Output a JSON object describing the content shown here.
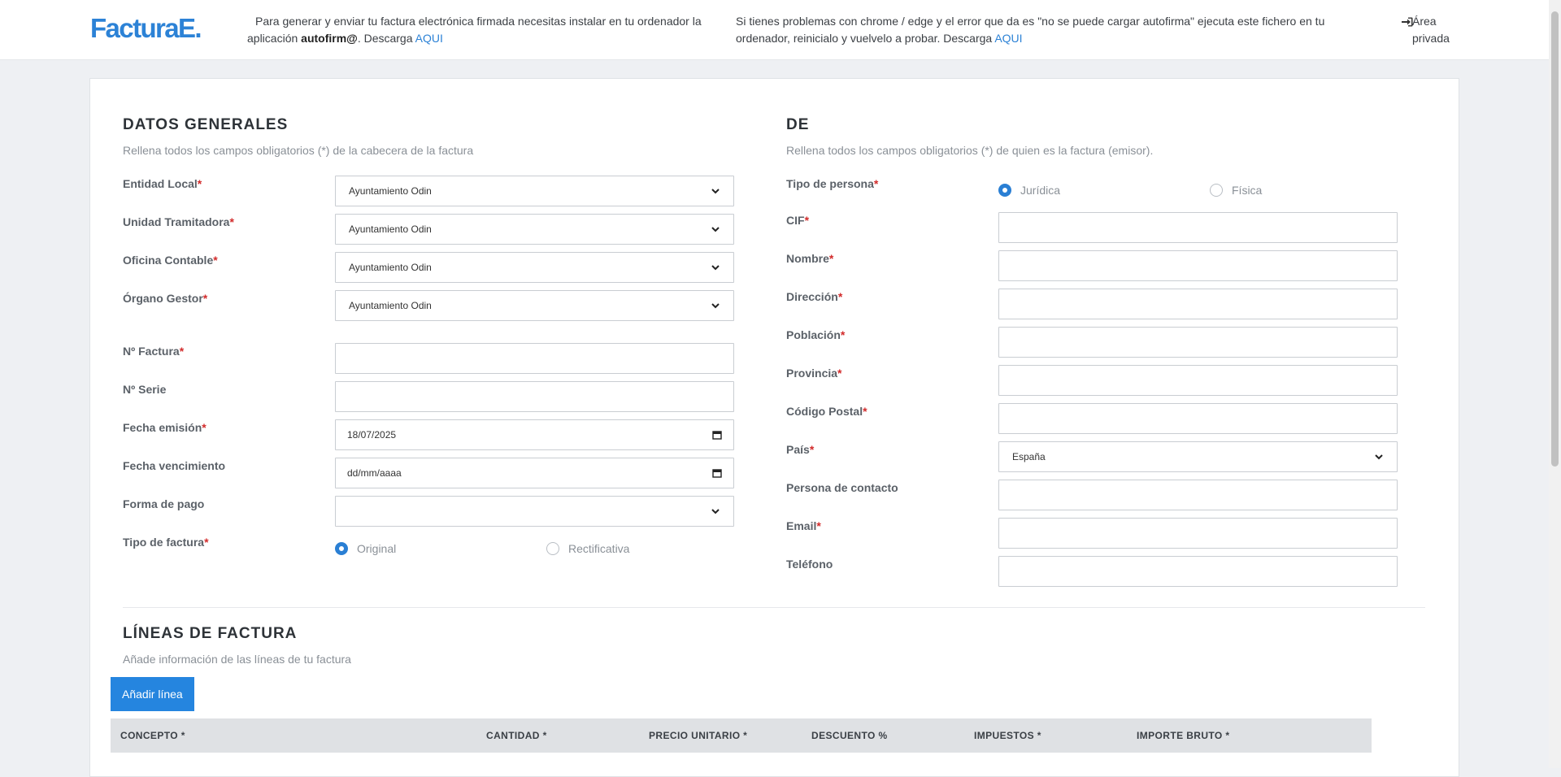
{
  "header": {
    "logo": "FacturaE.",
    "notice1": {
      "text_before": "Para generar y enviar tu factura electrónica firmada necesitas instalar en tu ordenador la aplicación ",
      "bold": "autofirm@",
      "text_after": ". Descarga ",
      "link": "AQUI"
    },
    "notice2": {
      "text_before": "Si tienes problemas con chrome / edge y el error que da es \"no se puede cargar autofirma\" ejecuta este fichero en tu ordenador, reinicialo y vuelvelo a probar. Descarga ",
      "link": "AQUI"
    },
    "private_area": "Área privada",
    "private_icon": "sign-in-icon"
  },
  "general": {
    "title": "DATOS GENERALES",
    "subtitle": "Rellena todos los campos obligatorios (*) de la cabecera de la factura",
    "required_mark": "*",
    "fields": {
      "entidad_local": {
        "label": "Entidad Local",
        "value": "Ayuntamiento Odin"
      },
      "unidad_tramitadora": {
        "label": "Unidad Tramitadora",
        "value": "Ayuntamiento Odin"
      },
      "oficina_contable": {
        "label": "Oficina Contable",
        "value": "Ayuntamiento Odin"
      },
      "organo_gestor": {
        "label": "Órgano Gestor",
        "value": "Ayuntamiento Odin"
      },
      "n_factura": {
        "label": "Nº Factura",
        "value": ""
      },
      "n_serie": {
        "label": "Nº Serie",
        "value": ""
      },
      "fecha_emision": {
        "label": "Fecha emisión",
        "value": "18/07/2025"
      },
      "fecha_vencimiento": {
        "label": "Fecha vencimiento",
        "value": "dd/mm/aaaa"
      },
      "forma_pago": {
        "label": "Forma de pago",
        "value": ""
      },
      "tipo_factura": {
        "label": "Tipo de factura",
        "options": [
          "Original",
          "Rectificativa"
        ],
        "selected": "Original"
      }
    }
  },
  "de": {
    "title": "DE",
    "subtitle": "Rellena todos los campos obligatorios (*) de quien es la factura (emisor).",
    "fields": {
      "tipo_persona": {
        "label": "Tipo de persona",
        "options": [
          "Jurídica",
          "Física"
        ],
        "selected": "Jurídica"
      },
      "cif": {
        "label": "CIF",
        "value": ""
      },
      "nombre": {
        "label": "Nombre",
        "value": ""
      },
      "direccion": {
        "label": "Dirección",
        "value": ""
      },
      "poblacion": {
        "label": "Población",
        "value": ""
      },
      "provincia": {
        "label": "Provincia",
        "value": ""
      },
      "codigo_postal": {
        "label": "Código Postal",
        "value": ""
      },
      "pais": {
        "label": "País",
        "value": "España"
      },
      "persona_contacto": {
        "label": "Persona de contacto",
        "value": ""
      },
      "email": {
        "label": "Email",
        "value": ""
      },
      "telefono": {
        "label": "Teléfono",
        "value": ""
      }
    }
  },
  "lineas": {
    "title": "LÍNEAS DE FACTURA",
    "subtitle": "Añade información de las líneas de tu factura",
    "add_button": "Añadir línea",
    "columns": [
      "CONCEPTO *",
      "CANTIDAD *",
      "PRECIO UNITARIO *",
      "DESCUENTO %",
      "IMPUESTOS *",
      "IMPORTE BRUTO *"
    ]
  },
  "colors": {
    "accent": "#2585df",
    "required": "#d22b2b"
  }
}
